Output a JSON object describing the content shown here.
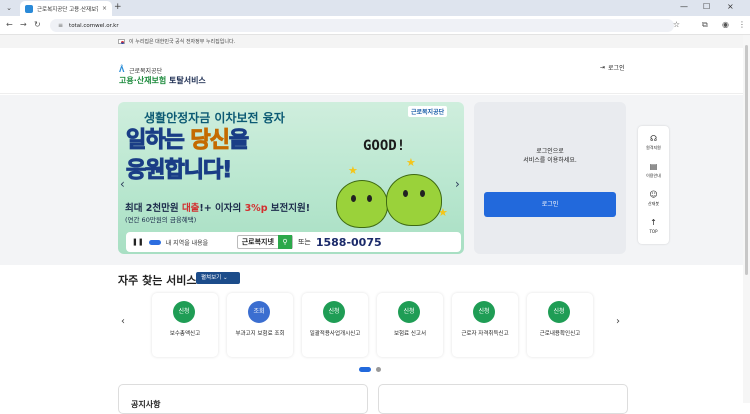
{
  "browser": {
    "tab_title": "근로복지공단 고용·산재보험 토",
    "tab_close": "×",
    "new_tab": "+",
    "url": "total.comwel.or.kr",
    "win_min": "—",
    "win_max": "☐",
    "win_close": "×"
  },
  "gov_banner": {
    "text": "이 누리집은 대한민국 공식 전자정부 누리집입니다."
  },
  "header": {
    "org": "근로복지공단",
    "service_green": "고용·산재보험",
    "service_dark": " 토탈서비스",
    "login_link": "로그인"
  },
  "banner": {
    "logo": "근로복지공단",
    "line1": "생활안정자금 이차보전 융자",
    "line2_a": "일하는 ",
    "line2_b": "당신",
    "line2_c": "을",
    "line3": "응원합니다!",
    "line4_a": "최대 2천만원 ",
    "line4_b": "대출",
    "line4_c": "!+ 이자의 ",
    "line4_d": "3%p",
    "line4_e": " 보전지원!",
    "line5": "(연간 60만원의 금융혜택)",
    "good": "GOOD!",
    "slide_caption": "내 지역을 내용을",
    "search_label": "근로복지넷",
    "or": "또는",
    "phone": "1588-0075"
  },
  "login_panel": {
    "line1": "로그인으로",
    "line2": "서비스를 이용하세요.",
    "button": "로그인"
  },
  "quick_menu": [
    {
      "label": "원격지원"
    },
    {
      "label": "이용안내"
    },
    {
      "label": "산재봇"
    },
    {
      "label": "TOP"
    }
  ],
  "services": {
    "title": "자주 찾는 서비스",
    "dropdown": "펼쳐보기",
    "items": [
      {
        "badge": "신청",
        "label": "보수총액신고"
      },
      {
        "badge": "조회",
        "label": "부과고지 보험료 조회"
      },
      {
        "badge": "신청",
        "label": "일괄적용사업개시신고"
      },
      {
        "badge": "신청",
        "label": "보험료 신고서"
      },
      {
        "badge": "신청",
        "label": "근로자 자격취득신고"
      },
      {
        "badge": "신청",
        "label": "근로내용확인신고"
      }
    ]
  },
  "footer": {
    "left_title": "공지사항"
  },
  "colors": {
    "accent": "#2269dc",
    "green": "#1f9d55",
    "navy": "#1c4c8a"
  }
}
